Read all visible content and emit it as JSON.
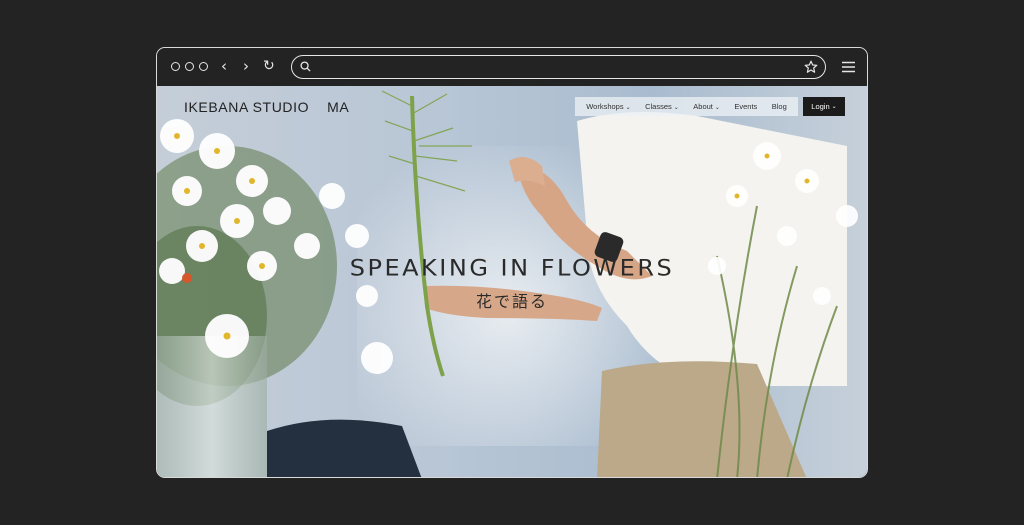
{
  "browser": {
    "url_value": "",
    "icons": [
      "circle-icon",
      "back-arrow-icon",
      "forward-arrow-icon",
      "reload-icon",
      "search-icon",
      "star-icon",
      "hamburger-menu-icon"
    ]
  },
  "site": {
    "logo": {
      "part1": "IKEBANA STUDIO",
      "part2": "MA"
    },
    "nav": [
      {
        "label": "Workshops",
        "has_dropdown": true
      },
      {
        "label": "Classes",
        "has_dropdown": true
      },
      {
        "label": "About",
        "has_dropdown": true
      },
      {
        "label": "Events",
        "has_dropdown": false
      },
      {
        "label": "Blog",
        "has_dropdown": false
      }
    ],
    "login_label": "Login",
    "hero": {
      "title": "SPEAKING IN FLOWERS",
      "subtitle": "花で語る"
    }
  },
  "colors": {
    "page_bg": "#232323",
    "frame": "#d9d9d9",
    "login_bg": "#1b1b1b"
  }
}
